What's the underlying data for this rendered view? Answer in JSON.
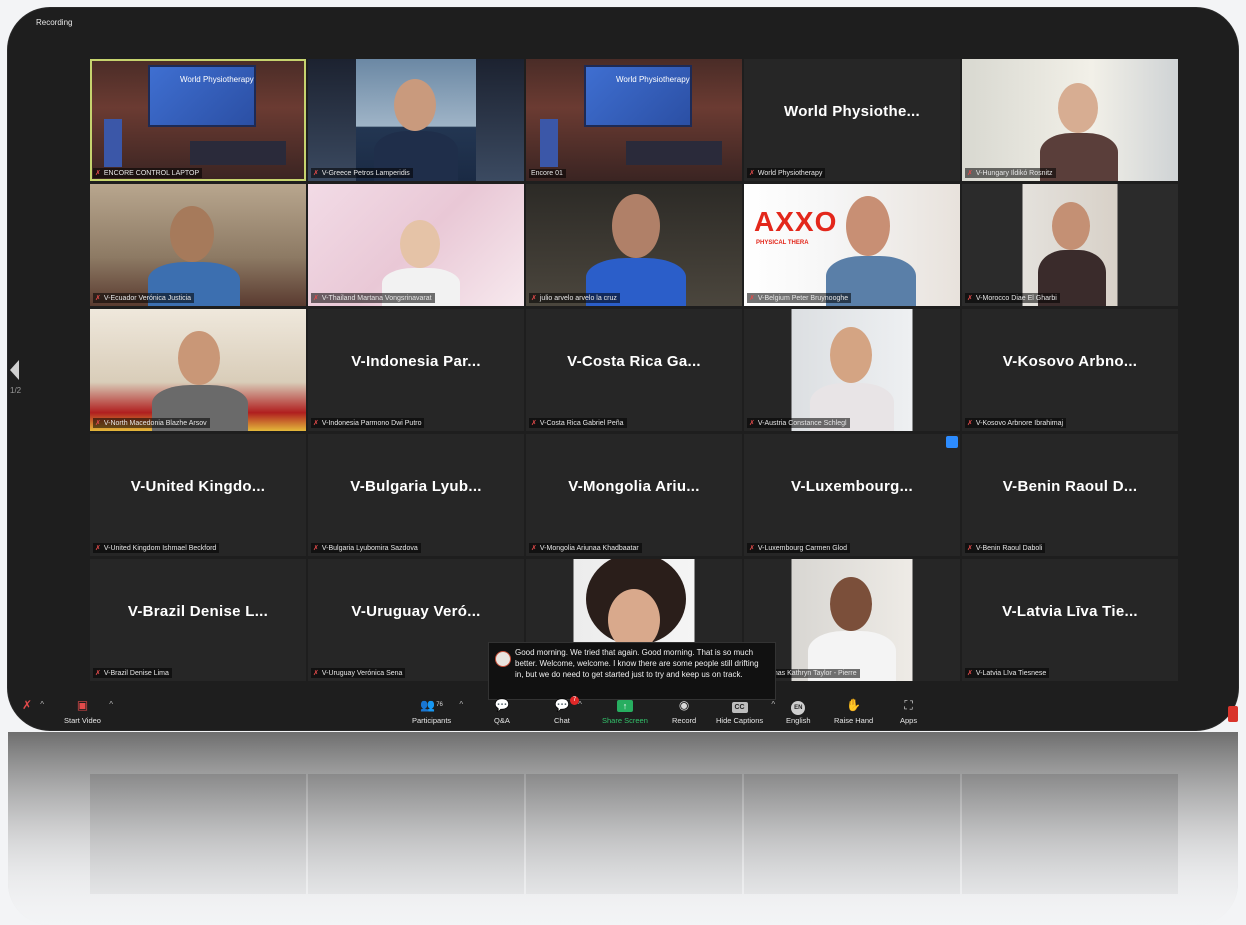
{
  "recording_label": "Recording",
  "page_indicator": "1/2",
  "tiles": [
    {
      "big": "",
      "name": "ENCORE CONTROL LAPTOP",
      "active": true,
      "projector_text": "World Physiotherapy"
    },
    {
      "big": "",
      "name": "V-Greece Petros Lamperidis"
    },
    {
      "big": "",
      "name": "Encore 01",
      "projector_text": "World Physiotherapy"
    },
    {
      "big": "World  Physiothe...",
      "name": "World Physiotherapy"
    },
    {
      "big": "",
      "name": "V-Hungary Ildikó Rosnitz"
    },
    {
      "big": "",
      "name": "V-Ecuador Verónica Justicia"
    },
    {
      "big": "",
      "name": "V-Thailand Martana Vongsrinavarat"
    },
    {
      "big": "",
      "name": "julio arvelo arvelo la cruz"
    },
    {
      "big": "",
      "name": "V-Belgium Peter Bruynooghe",
      "logo": "AXXO",
      "logo_sub": "PHYSICAL THERA"
    },
    {
      "big": "",
      "name": "V-Morocco Diae El Gharbi"
    },
    {
      "big": "",
      "name": "V-North Macedonia Blazhe Arsov"
    },
    {
      "big": "V-Indonesia  Par...",
      "name": "V-Indonesia Parmono Dwi Putro"
    },
    {
      "big": "V-Costa Rica  Ga...",
      "name": "V-Costa Rica Gabriel Peña"
    },
    {
      "big": "",
      "name": "V-Austria Constance Schlegl"
    },
    {
      "big": "V-Kosovo  Arbno...",
      "name": "V-Kosovo Arbnore Ibrahimaj"
    },
    {
      "big": "V-United  Kingdo...",
      "name": "V-United Kingdom Ishmael Beckford"
    },
    {
      "big": "V-Bulgaria  Lyub...",
      "name": "V-Bulgaria Lyubomira Sazdova"
    },
    {
      "big": "V-Mongolia  Ariu...",
      "name": "V-Mongolia Ariunaa Khadbaatar"
    },
    {
      "big": "V-Luxembourg...",
      "name": "V-Luxembourg Carmen Glod"
    },
    {
      "big": "V-Benin  Raoul  D...",
      "name": "V-Benin Raoul Daboli"
    },
    {
      "big": "V-Brazil  Denise  L...",
      "name": "V-Brazil Denise Lima"
    },
    {
      "big": "V-Uruguay  Veró...",
      "name": "V-Uruguay Verónica Sena"
    },
    {
      "big": "",
      "name": ""
    },
    {
      "big": "",
      "name": "V-Bahamas Kathryn Taylor - Pierre"
    },
    {
      "big": "V-Latvia  Līva  Tie...",
      "name": "V-Latvia Līva Tiesnese"
    }
  ],
  "caption": "Good morning. We tried that again. Good morning. That is so much better. Welcome, welcome. I know there are some people still drifting in, but we do need to get started just to try and keep us on track.",
  "toolbar": {
    "start_video": "Start Video",
    "participants": "Participants",
    "participants_count": "76",
    "qa": "Q&A",
    "chat": "Chat",
    "chat_badge": "7",
    "share_screen": "Share Screen",
    "record": "Record",
    "hide_captions": "Hide Captions",
    "english": "English",
    "english_badge": "EN",
    "cc_badge": "CC",
    "raise_hand": "Raise Hand",
    "apps": "Apps"
  },
  "colors": {
    "active_speaker": "#c6d36e",
    "share_green": "#27ae60",
    "mic_muted": "#e34b4b",
    "tile_bg": "#262626"
  }
}
